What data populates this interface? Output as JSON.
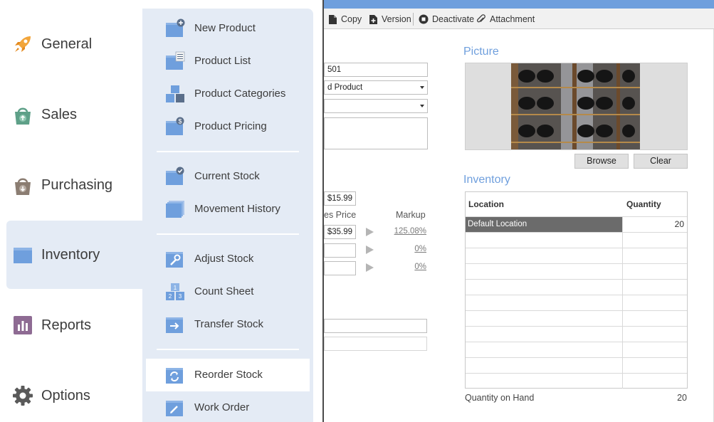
{
  "nav": {
    "items": [
      {
        "label": "General",
        "icon": "rocket-icon"
      },
      {
        "label": "Sales",
        "icon": "shopping-bag-up-icon"
      },
      {
        "label": "Purchasing",
        "icon": "shopping-bag-down-icon"
      },
      {
        "label": "Inventory",
        "icon": "box-icon",
        "active": true
      },
      {
        "label": "Reports",
        "icon": "bar-chart-icon"
      },
      {
        "label": "Options",
        "icon": "gear-icon"
      }
    ]
  },
  "flyout": {
    "items": [
      {
        "label": "New Product",
        "icon": "box-plus-icon"
      },
      {
        "label": "Product List",
        "icon": "box-list-icon"
      },
      {
        "label": "Product Categories",
        "icon": "boxes-icon"
      },
      {
        "label": "Product Pricing",
        "icon": "box-dollar-icon"
      },
      {
        "label": "Current Stock",
        "icon": "box-check-icon"
      },
      {
        "label": "Movement History",
        "icon": "box-stack-icon"
      },
      {
        "label": "Adjust Stock",
        "icon": "box-wrench-icon"
      },
      {
        "label": "Count Sheet",
        "icon": "box-count-icon"
      },
      {
        "label": "Transfer Stock",
        "icon": "box-arrow-icon"
      },
      {
        "label": "Reorder Stock",
        "icon": "box-refresh-icon",
        "selected": true
      },
      {
        "label": "Work Order",
        "icon": "box-pencil-icon"
      }
    ]
  },
  "toolbar": {
    "copy": "Copy",
    "version": "Version",
    "deactivate": "Deactivate",
    "attachment": "Attachment"
  },
  "form": {
    "product_code": "501",
    "product_type": "d Product",
    "pricing_header": "es Price",
    "markup_header": "Markup",
    "cost": "$15.99",
    "sales_price": "$35.99",
    "markups": [
      "125.08%",
      "0%",
      "0%"
    ]
  },
  "picture": {
    "title": "Picture",
    "browse": "Browse",
    "clear": "Clear"
  },
  "inventory": {
    "title": "Inventory",
    "col_location": "Location",
    "col_quantity": "Quantity",
    "rows": [
      {
        "location": "Default Location",
        "quantity": "20"
      }
    ],
    "qoh_label": "Quantity on Hand",
    "qoh_value": "20"
  },
  "colors": {
    "accent": "#6f9fdd",
    "flyout_bg": "#e4ebf5",
    "selected_row": "#6b6b6b"
  }
}
